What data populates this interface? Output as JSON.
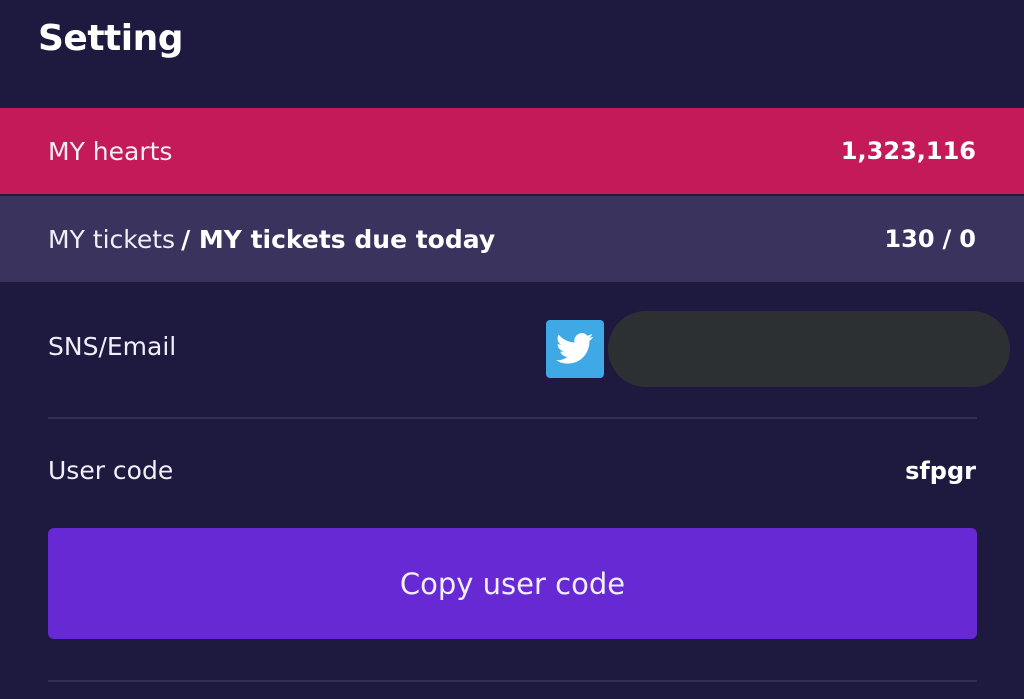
{
  "header": {
    "title": "Setting"
  },
  "hearts": {
    "label": "MY hearts",
    "value": "1,323,116",
    "bg_color": "#c41a59"
  },
  "tickets": {
    "label": "MY tickets",
    "label_bold": "/ MY tickets due today",
    "count": "130",
    "separator": "/",
    "due_today": "0"
  },
  "sns": {
    "label": "SNS/Email",
    "provider_icon": "twitter-icon",
    "provider_color": "#3fa9e6"
  },
  "user_code": {
    "label": "User code",
    "value": "sfpgr"
  },
  "copy_button": {
    "label": "Copy user code",
    "color": "#6629d4"
  }
}
